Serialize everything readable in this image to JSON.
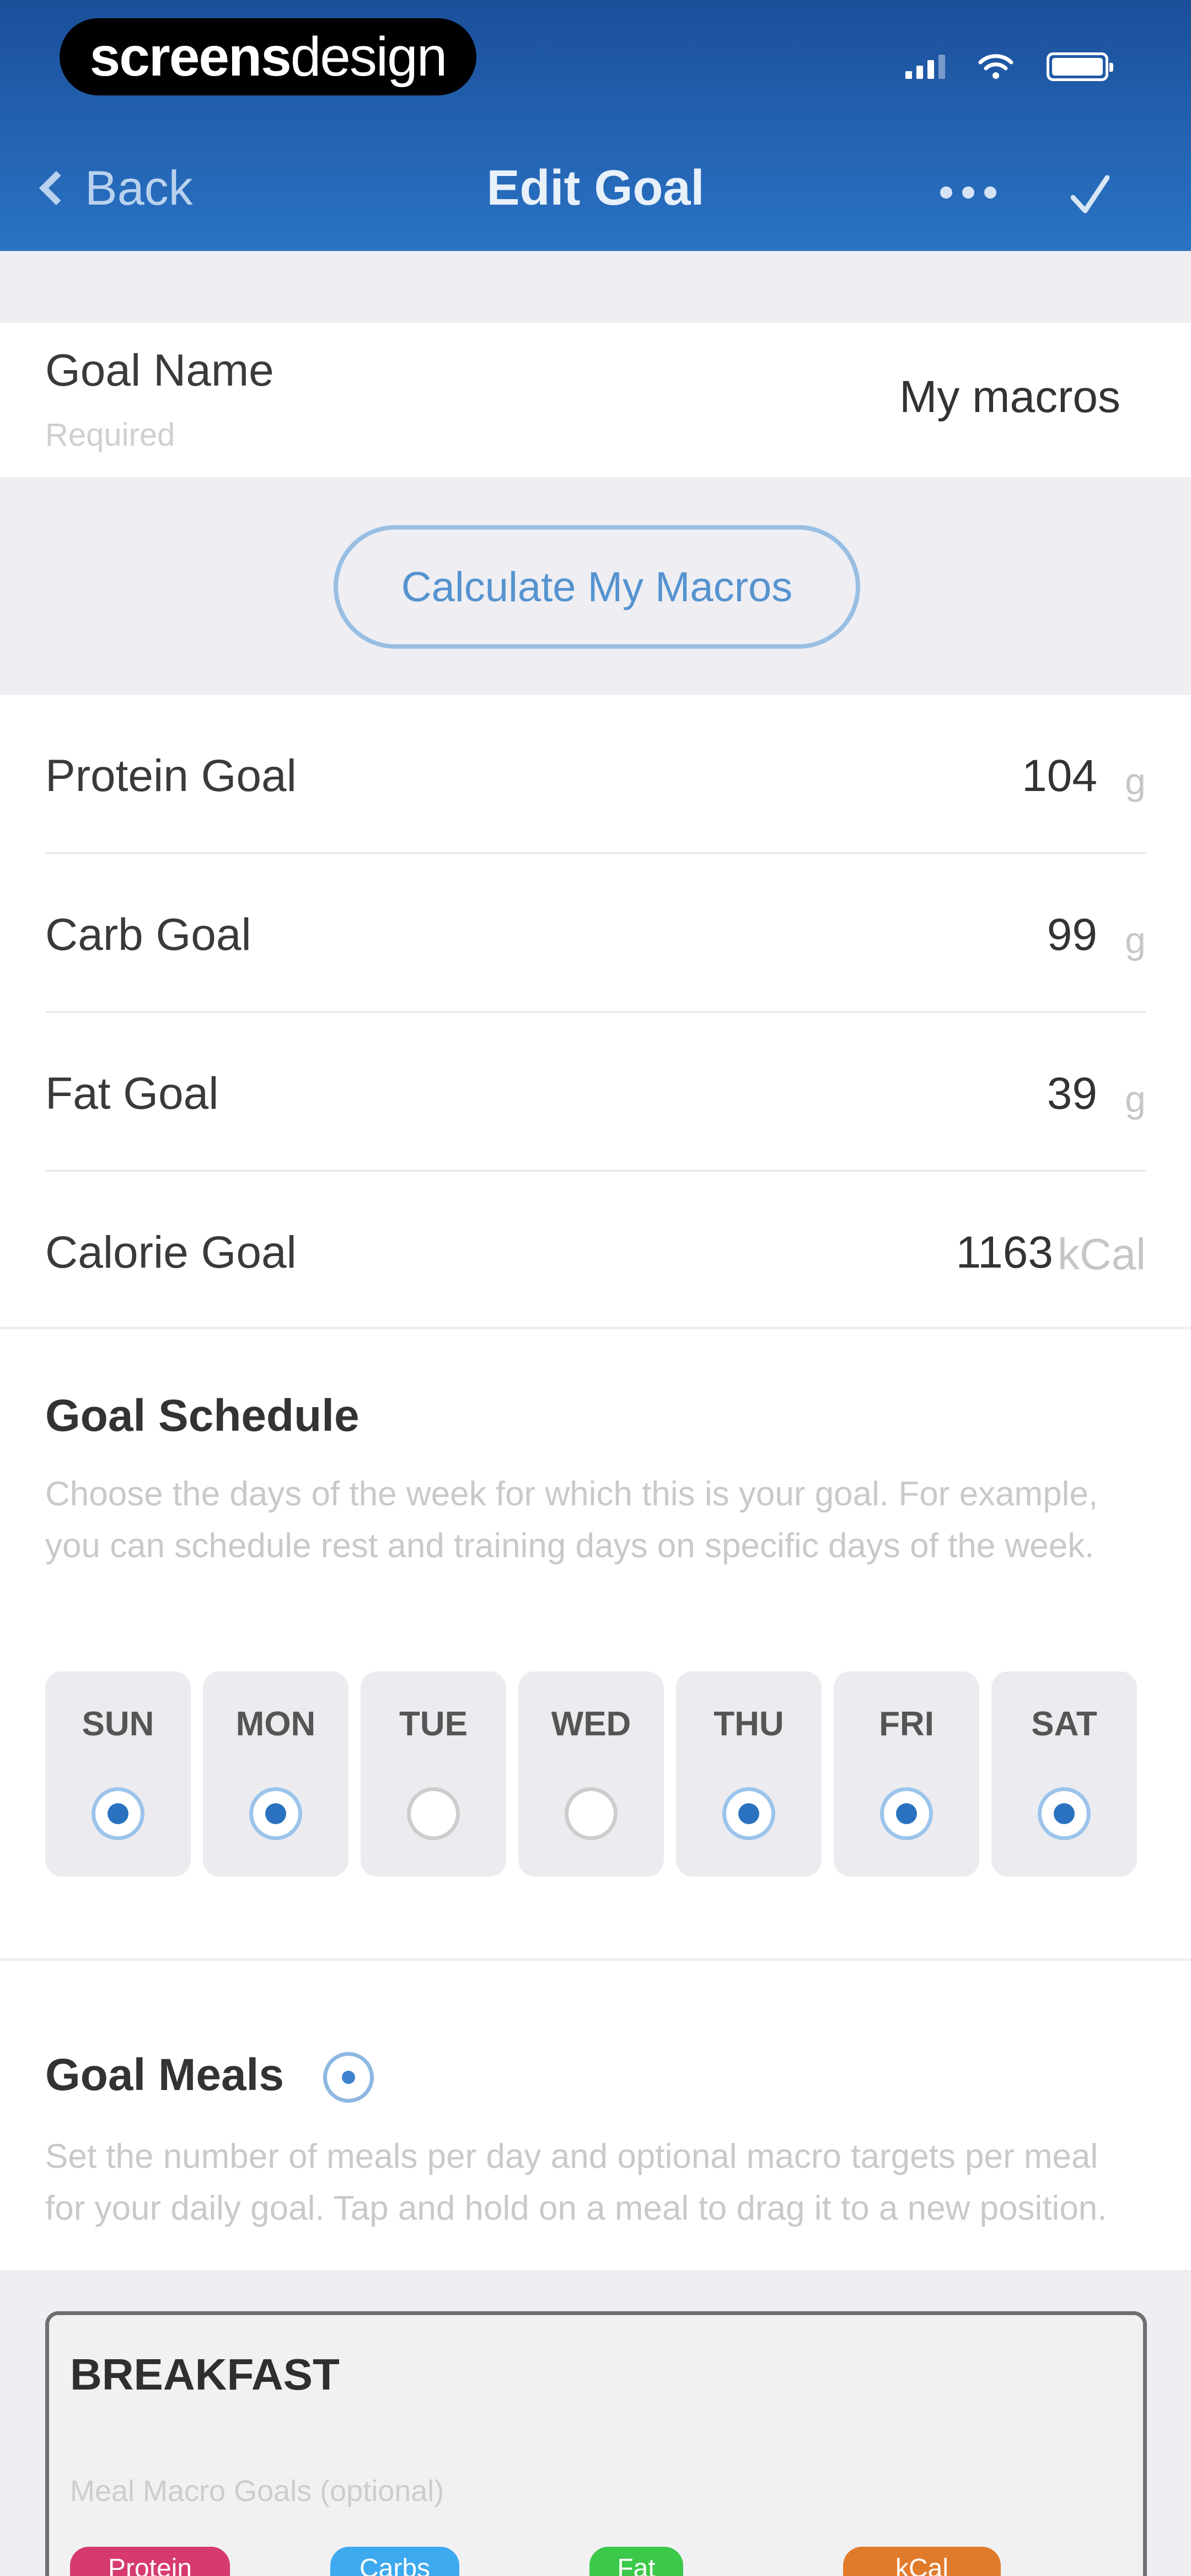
{
  "status_bar": {
    "brand_bold": "screens",
    "brand_thin": "design",
    "signal_icon": "signal-icon",
    "wifi_icon": "wifi-icon",
    "battery_icon": "battery-icon"
  },
  "nav": {
    "back_label": "Back",
    "title": "Edit Goal",
    "more_icon": "more-icon",
    "confirm_icon": "checkmark-icon"
  },
  "goal_name": {
    "label": "Goal Name",
    "sublabel": "Required",
    "value": "My macros"
  },
  "calculate_button": "Calculate My Macros",
  "macros": [
    {
      "label": "Protein Goal",
      "value": "104",
      "unit": "g"
    },
    {
      "label": "Carb Goal",
      "value": "99",
      "unit": "g"
    },
    {
      "label": "Fat Goal",
      "value": "39",
      "unit": "g"
    },
    {
      "label": "Calorie Goal",
      "value": "1163",
      "unit": "kCal"
    }
  ],
  "schedule": {
    "title": "Goal Schedule",
    "description": "Choose the days of the week for which this is your goal. For example, you can schedule rest and training days on specific days of the week.",
    "days": [
      {
        "name": "SUN",
        "selected": true
      },
      {
        "name": "MON",
        "selected": true
      },
      {
        "name": "TUE",
        "selected": false
      },
      {
        "name": "WED",
        "selected": false
      },
      {
        "name": "THU",
        "selected": true
      },
      {
        "name": "FRI",
        "selected": true
      },
      {
        "name": "SAT",
        "selected": true
      }
    ]
  },
  "meals": {
    "title": "Goal Meals",
    "add_icon": "add-circle-icon",
    "description": "Set the number of meals per day and optional macro targets per meal for your daily goal. Tap and hold on a meal to drag it to a new position.",
    "breakfast": {
      "title": "BREAKFAST",
      "subtitle": "Meal Macro Goals (optional)",
      "chips": [
        "Protein",
        "Carbs",
        "Fat",
        "kCal"
      ]
    }
  },
  "colors": {
    "header_top": "#1b4f9a",
    "header_bottom": "#2a73c4",
    "accent": "#2a72c0",
    "protein": "#d63a6e",
    "carbs": "#3da9ee",
    "fat": "#3cc94a",
    "kcal": "#e17b2c"
  }
}
